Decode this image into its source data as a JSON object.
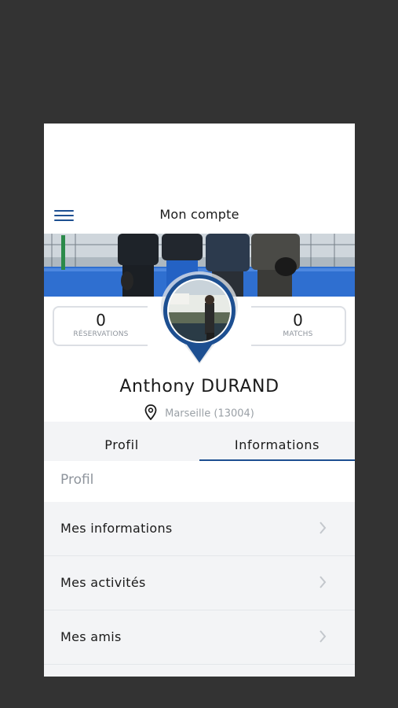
{
  "header": {
    "title": "Mon compte"
  },
  "stats": {
    "reservations_count": "0",
    "reservations_label": "RÉSERVATIONS",
    "matchs_count": "0",
    "matchs_label": "MATCHS"
  },
  "user": {
    "name": "Anthony DURAND",
    "location": "Marseille (13004)"
  },
  "tabs": [
    {
      "label": "Profil",
      "active": false
    },
    {
      "label": "Informations",
      "active": true
    }
  ],
  "section": {
    "title": "Profil"
  },
  "menu": [
    {
      "label": "Mes informations"
    },
    {
      "label": "Mes activités"
    },
    {
      "label": "Mes amis"
    }
  ],
  "colors": {
    "accent": "#1d4f91",
    "background": "#333333",
    "muted_text": "#8e949c",
    "list_bg": "#f3f4f6"
  },
  "icons": [
    "menu-icon",
    "location-pin-icon",
    "chevron-right-icon"
  ]
}
